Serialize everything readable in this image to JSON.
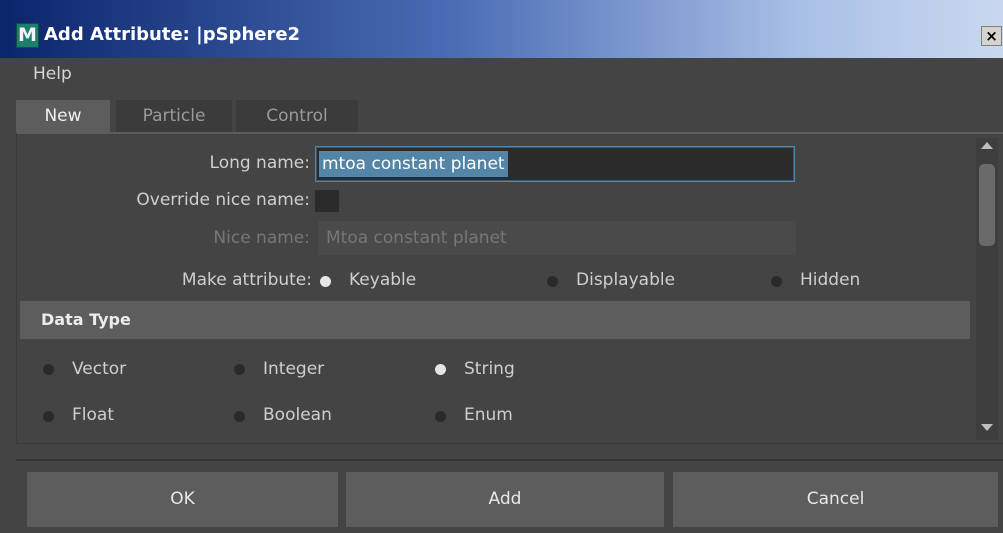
{
  "window": {
    "title": "Add Attribute: |pSphere2",
    "logo_letter": "M",
    "close_glyph": "×"
  },
  "menu": {
    "help": "Help"
  },
  "tabs": [
    {
      "label": "New",
      "active": true
    },
    {
      "label": "Particle",
      "active": false
    },
    {
      "label": "Control",
      "active": false
    }
  ],
  "form": {
    "long_name_label": "Long name:",
    "long_name_value": "mtoa constant planet",
    "override_label": "Override nice name:",
    "override_checked": false,
    "nice_name_label": "Nice name:",
    "nice_name_value": "Mtoa constant planet",
    "make_attribute_label": "Make attribute:",
    "make_attribute_options": [
      {
        "label": "Keyable",
        "selected": true
      },
      {
        "label": "Displayable",
        "selected": false
      },
      {
        "label": "Hidden",
        "selected": false
      }
    ]
  },
  "data_type": {
    "heading": "Data Type",
    "options": [
      {
        "label": "Vector",
        "selected": false
      },
      {
        "label": "Integer",
        "selected": false
      },
      {
        "label": "String",
        "selected": true
      },
      {
        "label": "Float",
        "selected": false
      },
      {
        "label": "Boolean",
        "selected": false
      },
      {
        "label": "Enum",
        "selected": false
      }
    ]
  },
  "buttons": {
    "ok": "OK",
    "add": "Add",
    "cancel": "Cancel"
  },
  "colors": {
    "background": "#444444",
    "accent": "#5285a6",
    "title_bar_start": "#0b256b"
  },
  "icons": {
    "app": "maya-icon",
    "close": "close-icon",
    "scroll_up": "arrow-up-icon",
    "scroll_down": "arrow-down-icon"
  }
}
